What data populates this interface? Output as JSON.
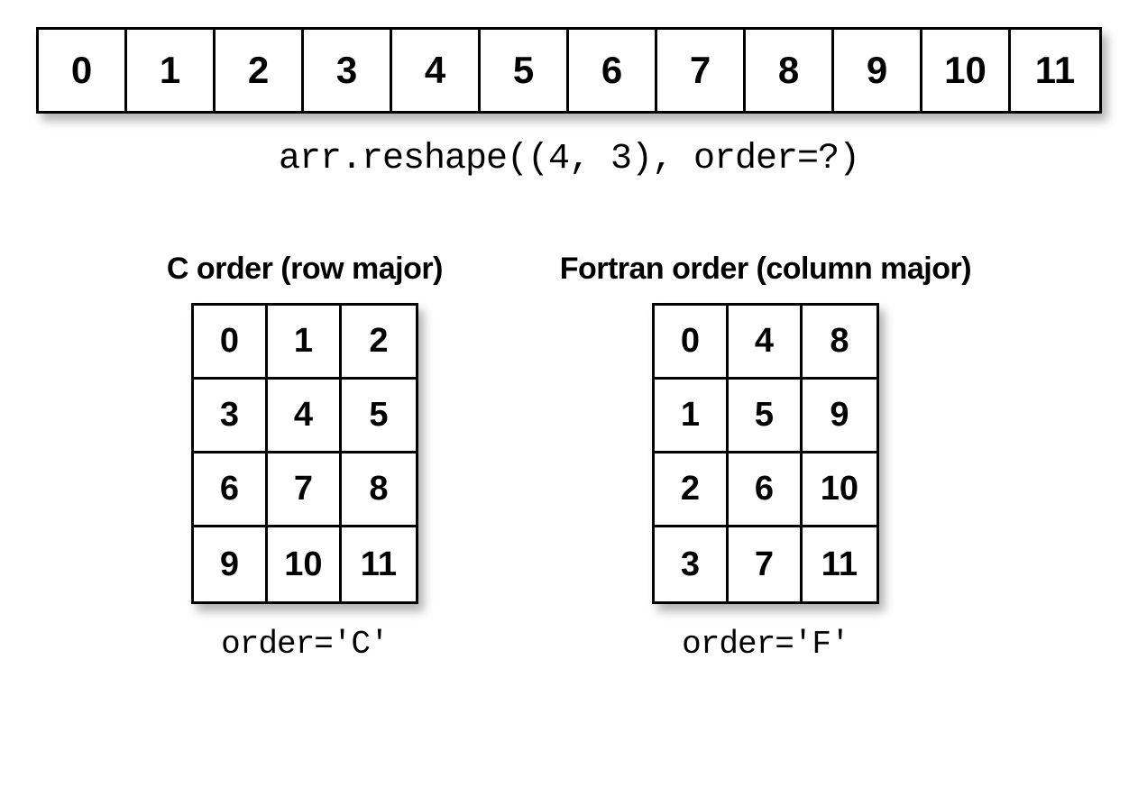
{
  "top_array": [
    "0",
    "1",
    "2",
    "3",
    "4",
    "5",
    "6",
    "7",
    "8",
    "9",
    "10",
    "11"
  ],
  "reshape_label": "arr.reshape((4, 3), order=?)",
  "left": {
    "title": "C order (row major)",
    "matrix": [
      [
        "0",
        "1",
        "2"
      ],
      [
        "3",
        "4",
        "5"
      ],
      [
        "6",
        "7",
        "8"
      ],
      [
        "9",
        "10",
        "11"
      ]
    ],
    "order_label": "order='C'"
  },
  "right": {
    "title": "Fortran order (column major)",
    "matrix": [
      [
        "0",
        "4",
        "8"
      ],
      [
        "1",
        "5",
        "9"
      ],
      [
        "2",
        "6",
        "10"
      ],
      [
        "3",
        "7",
        "11"
      ]
    ],
    "order_label": "order='F'"
  }
}
